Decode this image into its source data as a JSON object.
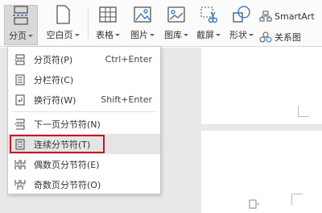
{
  "ribbon": {
    "page_break": "分页",
    "blank_page": "空白页",
    "table": "表格",
    "picture": "图片",
    "gallery": "图库",
    "screenshot": "截屏",
    "shapes": "形状",
    "smartart": "SmartArt",
    "relation_chart": "关系图"
  },
  "menu": {
    "items": [
      {
        "label": "分页符(P)",
        "shortcut": "Ctrl+Enter",
        "icon": "page-break-icon"
      },
      {
        "label": "分栏符(C)",
        "shortcut": "",
        "icon": "column-break-icon"
      },
      {
        "label": "换行符(W)",
        "shortcut": "Shift+Enter",
        "icon": "line-break-icon"
      },
      {
        "label": "下一页分节符(N)",
        "shortcut": "",
        "icon": "next-page-section-icon"
      },
      {
        "label": "连续分节符(T)",
        "shortcut": "",
        "icon": "continuous-section-icon",
        "highlighted": true
      },
      {
        "label": "偶数页分节符(E)",
        "shortcut": "",
        "icon": "even-page-section-icon"
      },
      {
        "label": "奇数页分节符(O)",
        "shortcut": "",
        "icon": "odd-page-section-icon"
      }
    ]
  },
  "colors": {
    "highlight_border": "#c8161d",
    "icon_blue": "#2f6fb7"
  }
}
